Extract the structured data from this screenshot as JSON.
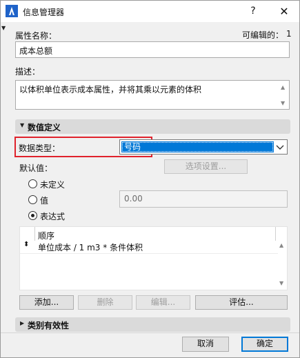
{
  "window": {
    "title": "信息管理器",
    "help_label": "?",
    "close_label": "✕"
  },
  "property": {
    "name_label": "属性名称：",
    "editable_label": "可编辑的：",
    "editable_value": "1",
    "name_value": "成本总额",
    "description_label": "描述：",
    "description_value": "以体积单位表示成本属性，并将其乘以元素的体积"
  },
  "value_definition": {
    "header": "数值定义",
    "data_type_label": "数据类型：",
    "data_type_value": "号码",
    "default_label": "默认值：",
    "options_button": "选项设置...",
    "radio_undefined": "未定义",
    "radio_value": "值",
    "value_input": "0.00",
    "radio_expression": "表达式",
    "list_header": "顺序",
    "expression_row": "单位成本 / 1 m3 * 条件体积",
    "add_button": "添加...",
    "delete_button": "删除",
    "edit_button": "编辑...",
    "evaluate_button": "评估..."
  },
  "category_validity": {
    "header": "类别有效性"
  },
  "footer": {
    "cancel_button": "取消",
    "ok_button": "确定"
  },
  "colors": {
    "selection": "#0078d7",
    "highlight_border": "#e0212b",
    "primary_border": "#0078d7"
  }
}
